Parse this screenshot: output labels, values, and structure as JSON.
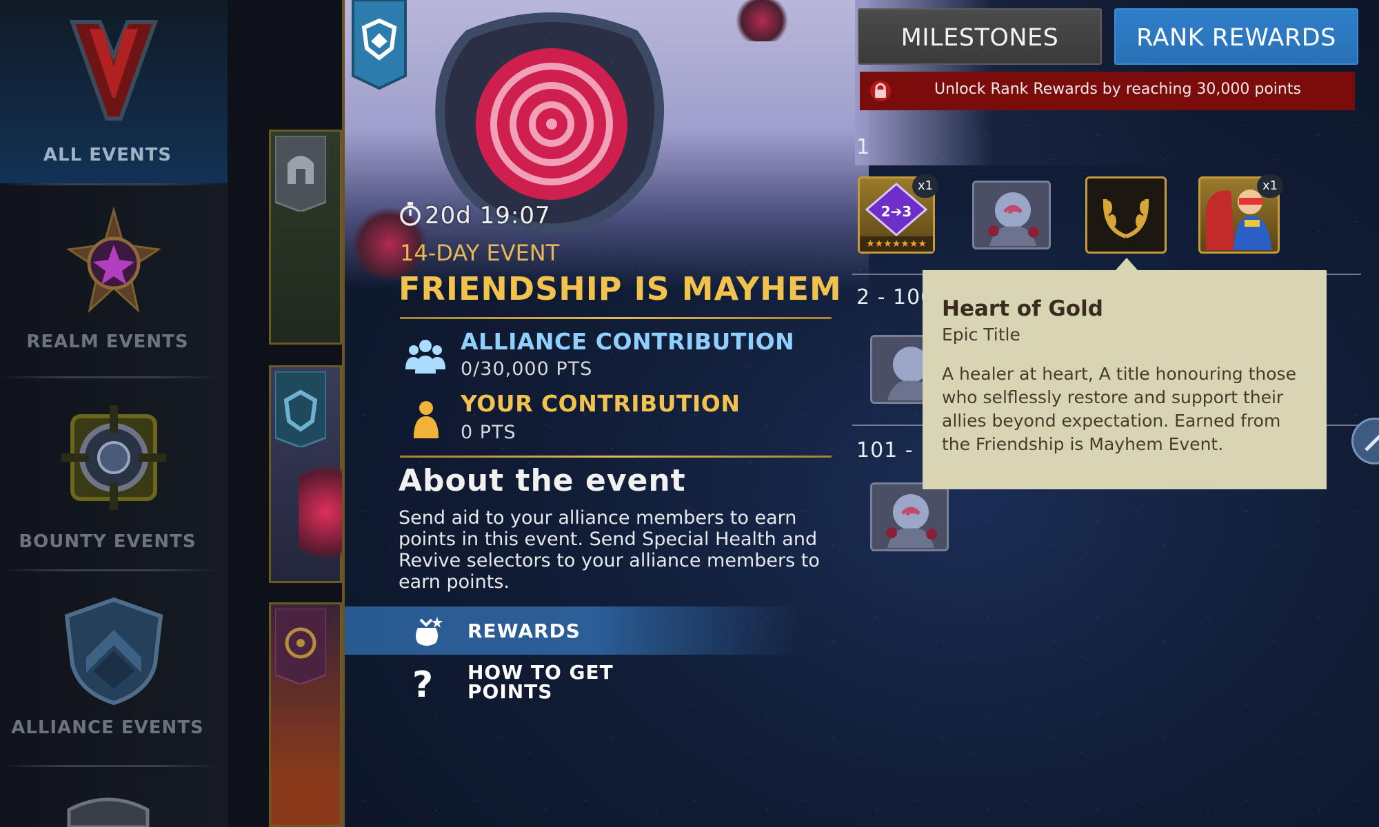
{
  "sidebar": {
    "items": [
      {
        "label": "ALL EVENTS",
        "icon": "contest-v-icon",
        "active": true
      },
      {
        "label": "REALM EVENTS",
        "icon": "realm-star-icon",
        "active": false
      },
      {
        "label": "BOUNTY EVENTS",
        "icon": "bounty-target-icon",
        "active": false
      },
      {
        "label": "ALLIANCE EVENTS",
        "icon": "alliance-shield-icon",
        "active": false
      }
    ]
  },
  "event": {
    "timer": "20d 19:07",
    "type": "14-DAY EVENT",
    "title": "FRIENDSHIP IS MAYHEM",
    "alliance_contribution": {
      "label": "ALLIANCE CONTRIBUTION",
      "value": "0/30,000 PTS"
    },
    "your_contribution": {
      "label": "YOUR CONTRIBUTION",
      "value": "0 PTS"
    },
    "about_heading": "About the event",
    "about_body": "Send aid to your alliance members to earn points in this event. Send Special Health and Revive selectors to your alliance members to earn points."
  },
  "nav": {
    "rewards": "REWARDS",
    "how_to": "HOW TO GET POINTS"
  },
  "tabs": {
    "milestones": "MILESTONES",
    "rank_rewards": "RANK REWARDS"
  },
  "lock_notice": "Unlock Rank Rewards by reaching 30,000 points",
  "ranks": [
    {
      "label": "1",
      "rewards": [
        "rank-up-gem-2-3",
        "avatar-mayhem",
        "title-laurel",
        "champion-cyclops"
      ]
    },
    {
      "label": "2 - 100",
      "rewards": [
        "avatar-mayhem"
      ]
    },
    {
      "label": "101 - 1000",
      "rewards": [
        "avatar-mayhem"
      ]
    }
  ],
  "reward_badges": {
    "gem_qty": "x1",
    "gem_text": "2➔3",
    "gem_stars": "★★★★★★★",
    "champion_qty": "x1"
  },
  "tooltip": {
    "title": "Heart of Gold",
    "subtitle": "Epic Title",
    "description": "A healer at heart, A title honouring those who selflessly restore and support their allies beyond expectation. Earned from the Friendship is Mayhem Event."
  },
  "colors": {
    "gold": "#f2c24f",
    "alliance_blue": "#8fd0ff",
    "rank_blue": "#2f7fc9",
    "lock_red": "#7a0c0c",
    "tooltip_bg": "#d7d5b3"
  }
}
